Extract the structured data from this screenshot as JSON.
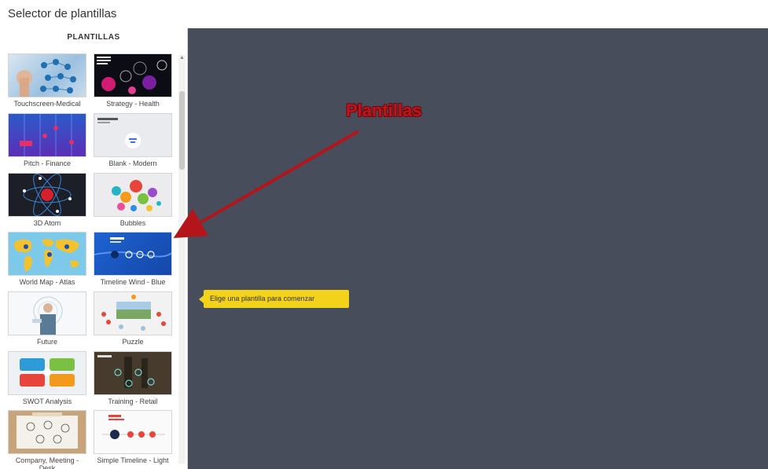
{
  "window": {
    "title": "Selector de plantillas"
  },
  "sidebar": {
    "header": "PLANTILLAS",
    "templates": [
      {
        "label": "Touchscreen-Medical"
      },
      {
        "label": "Strategy - Health"
      },
      {
        "label": "Pitch - Finance"
      },
      {
        "label": "Blank - Modern"
      },
      {
        "label": "3D Atom"
      },
      {
        "label": "Bubbles"
      },
      {
        "label": "World Map - Atlas"
      },
      {
        "label": "Timeline Wind - Blue"
      },
      {
        "label": "Future"
      },
      {
        "label": "Puzzle"
      },
      {
        "label": "SWOT Analysis"
      },
      {
        "label": "Training - Retail"
      },
      {
        "label": "Company, Meeting - Desk"
      },
      {
        "label": "Simple Timeline - Light"
      }
    ]
  },
  "canvas": {
    "tooltip": "Elige una plantilla para comenzar"
  },
  "annotation": {
    "text": "Plantillas",
    "color": "#c0141b"
  }
}
